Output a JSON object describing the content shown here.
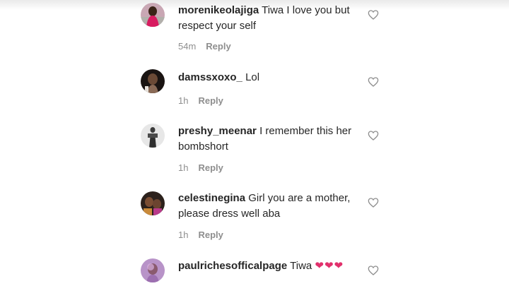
{
  "comments": [
    {
      "username": "morenikeolajiga",
      "text": "Tiwa I love you but respect your self",
      "time": "54m",
      "reply": "Reply",
      "avatar": "avatar-photo"
    },
    {
      "username": "damssxoxo_",
      "text": "Lol",
      "time": "1h",
      "reply": "Reply",
      "avatar": "avatar-photo"
    },
    {
      "username": "preshy_meenar",
      "text": "I remember this her bombshort",
      "time": "1h",
      "reply": "Reply",
      "avatar": "avatar-photo"
    },
    {
      "username": "celestinegina",
      "text": "Girl you are a mother, please dress well aba",
      "time": "1h",
      "reply": "Reply",
      "avatar": "avatar-photo"
    },
    {
      "username": "paulrichesofficalpage",
      "text": "Tiwa",
      "emoji": "❤❤❤",
      "time": "",
      "reply": "",
      "avatar": "avatar-photo"
    }
  ],
  "icons": {
    "like": "heart-outline-icon"
  },
  "colors": {
    "text": "#262626",
    "meta": "#8e8e8e",
    "emoji_heart": "#e1306c"
  }
}
